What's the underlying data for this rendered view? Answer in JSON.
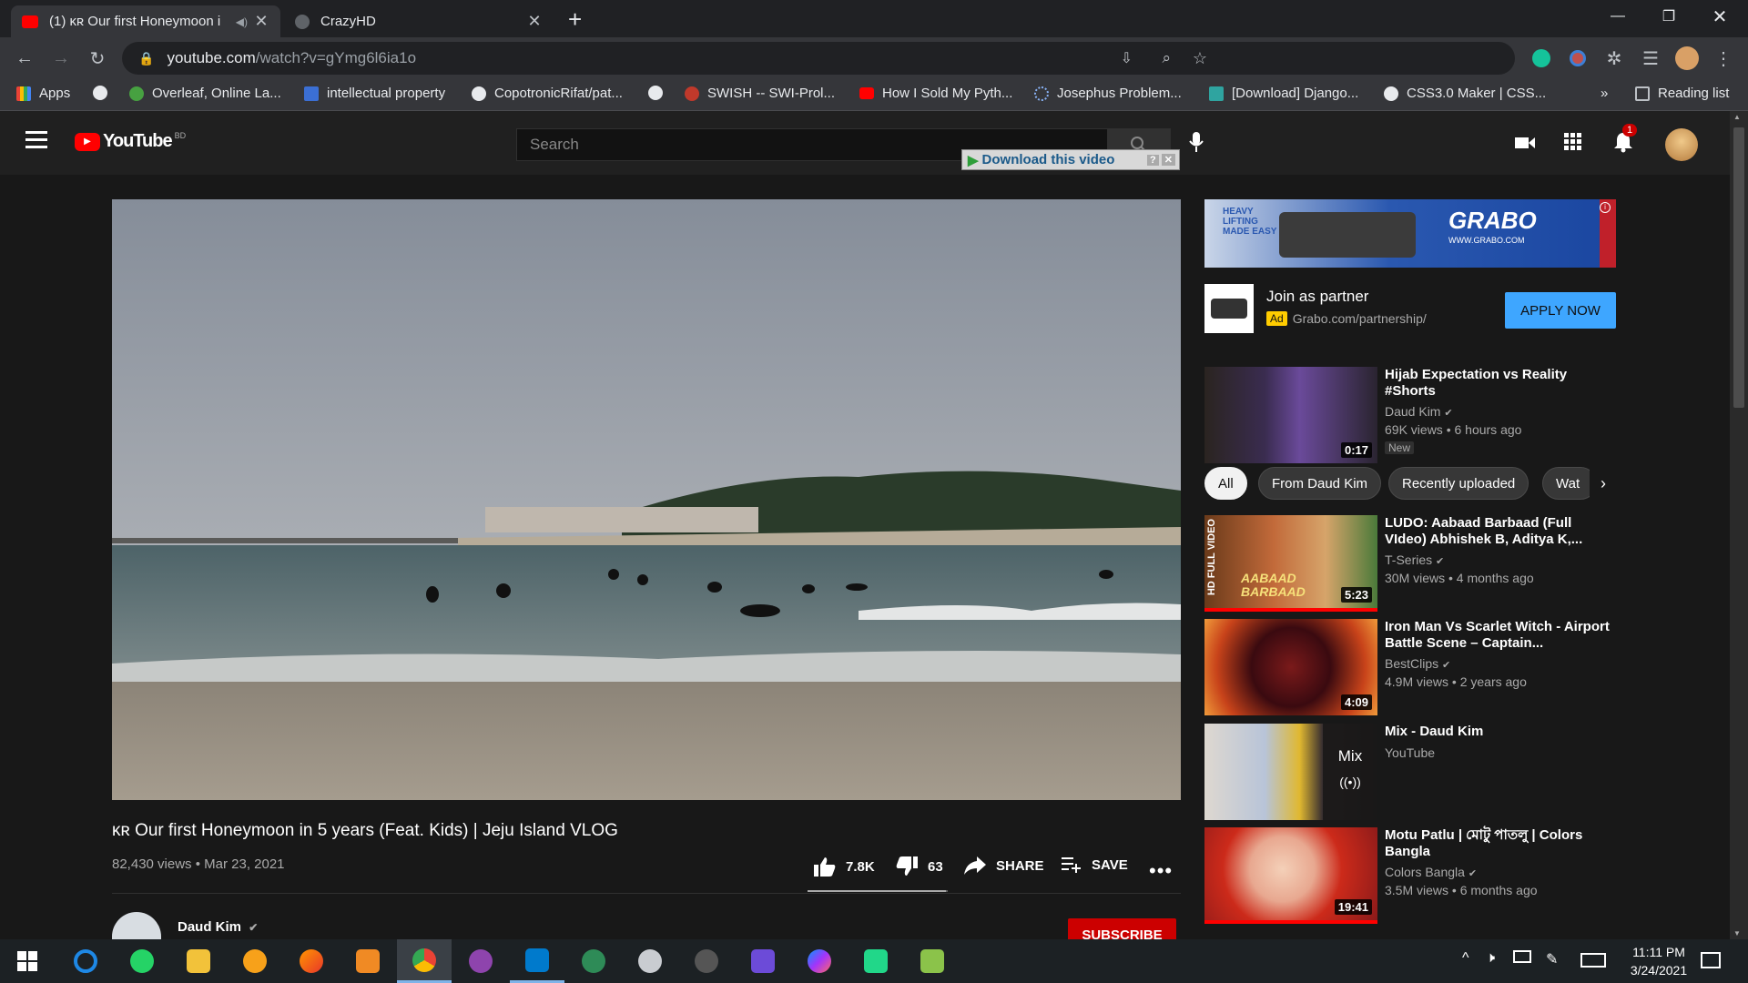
{
  "browser": {
    "tabs": [
      {
        "title": "(1) ᴋʀ Our first Honeymoon i",
        "active": true
      },
      {
        "title": "CrazyHD",
        "active": false
      }
    ],
    "url_host": "youtube.com",
    "url_path": "/watch?v=gYmg6l6ia1o",
    "bookmarks": [
      {
        "label": "Apps"
      },
      {
        "label": ""
      },
      {
        "label": "Overleaf, Online La..."
      },
      {
        "label": "intellectual property"
      },
      {
        "label": "CopotronicRifat/pat..."
      },
      {
        "label": ""
      },
      {
        "label": "SWISH -- SWI-Prol..."
      },
      {
        "label": "How I Sold My Pyth..."
      },
      {
        "label": "Josephus Problem..."
      },
      {
        "label": "[Download] Django..."
      },
      {
        "label": "CSS3.0 Maker | CSS..."
      }
    ],
    "bookmarks_overflow": "»",
    "reading_list": "Reading list"
  },
  "youtube": {
    "logo_text": "YouTube",
    "country_code": "BD",
    "search_placeholder": "Search",
    "download_bar": "Download this video",
    "notification_count": "1",
    "video": {
      "title": "ᴋʀ Our first Honeymoon in 5 years (Feat. Kids) | Jeju Island VLOG",
      "views_date": "82,430 views • Mar 23, 2021",
      "likes": "7.8K",
      "dislikes": "63",
      "share": "SHARE",
      "save": "SAVE",
      "like_ratio": 0.99
    },
    "channel": {
      "name": "Daud Kim",
      "subscribe": "SUBSCRIBE"
    },
    "ad": {
      "title": "Join as partner",
      "badge": "Ad",
      "url": "Grabo.com/partnership/",
      "cta": "APPLY NOW",
      "banner_brand": "GRABO",
      "banner_slogan": "HEAVY LIFTING MADE EASY",
      "banner_url": "WWW.GRABO.COM"
    },
    "chips": [
      "All",
      "From Daud Kim",
      "Recently uploaded",
      "Wat"
    ],
    "recommendations": [
      {
        "title": "Hijab Expectation vs Reality #Shorts",
        "channel": "Daud Kim",
        "meta": "69K views • 6 hours ago",
        "badge": "New",
        "duration": "0:17"
      },
      {
        "title": "LUDO: Aabaad Barbaad (Full VIdeo) Abhishek B, Aditya K,...",
        "channel": "T-Series",
        "meta": "30M views • 4 months ago",
        "duration": "5:23",
        "thumb_text": "AABAAD BARBAAD",
        "side_text": "HD FULL VIDEO"
      },
      {
        "title": "Iron Man Vs Scarlet Witch - Airport Battle Scene – Captain...",
        "channel": "BestClips",
        "meta": "4.9M views • 2 years ago",
        "duration": "4:09"
      },
      {
        "title": "Mix - Daud Kim",
        "channel": "YouTube",
        "meta": "",
        "duration": "",
        "mix_label": "Mix"
      },
      {
        "title": "Motu Patlu | মোটু পাতলু | Colors Bangla",
        "channel": "Colors Bangla",
        "meta": "3.5M views • 6 months ago",
        "duration": "19:41"
      }
    ]
  },
  "taskbar": {
    "time": "11:11 PM",
    "date": "3/24/2021"
  }
}
